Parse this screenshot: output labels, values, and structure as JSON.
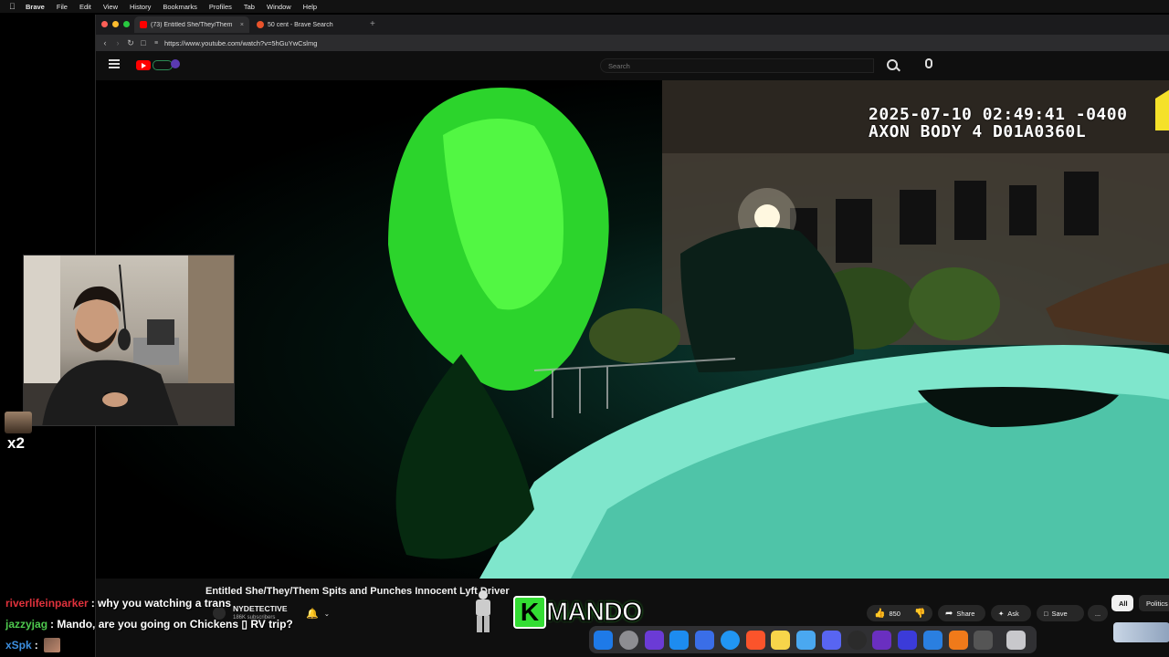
{
  "menubar": {
    "app_name": "Brave",
    "items": [
      "File",
      "Edit",
      "View",
      "History",
      "Bookmarks",
      "Profiles",
      "Tab",
      "Window",
      "Help"
    ]
  },
  "browser": {
    "tabs": [
      {
        "label": "(73) Entitled She/They/Them",
        "active": true
      },
      {
        "label": "50 cent - Brave Search",
        "active": false
      }
    ],
    "url": "https://www.youtube.com/watch?v=5hGuYwCslmg"
  },
  "youtube": {
    "search_placeholder": "Search",
    "video_overlay": {
      "timestamp": "2025-07-10 02:49:41 -0400",
      "device": "AXON BODY 4 D01A0360L"
    },
    "video_title": "Entitled She/They/Them Spits and Punches Innocent Lyft Driver",
    "channel": {
      "name": "NYDETECTIVE",
      "subscribers": "186K subscribers"
    },
    "actions": {
      "likes": "850",
      "share": "Share",
      "ask": "Ask",
      "save": "Save",
      "more": "..."
    },
    "chips": [
      "All",
      "Politics"
    ]
  },
  "stream_overlay": {
    "viewer_badge": "x2",
    "brand": "MANDO",
    "chat": [
      {
        "user": "riverlifeinparker",
        "message": ": why you watching a trans",
        "color": "#e0323c"
      },
      {
        "user": "jazzyjag",
        "message": ": Mando, are you going on Chickens ▯ RV trip?",
        "color": "#4ec94e"
      },
      {
        "user": "xSpk",
        "message": ":",
        "color": "#3d8fe0"
      }
    ]
  },
  "colors": {
    "accent_green": "#33dd33",
    "youtube_red": "#ff0000"
  }
}
